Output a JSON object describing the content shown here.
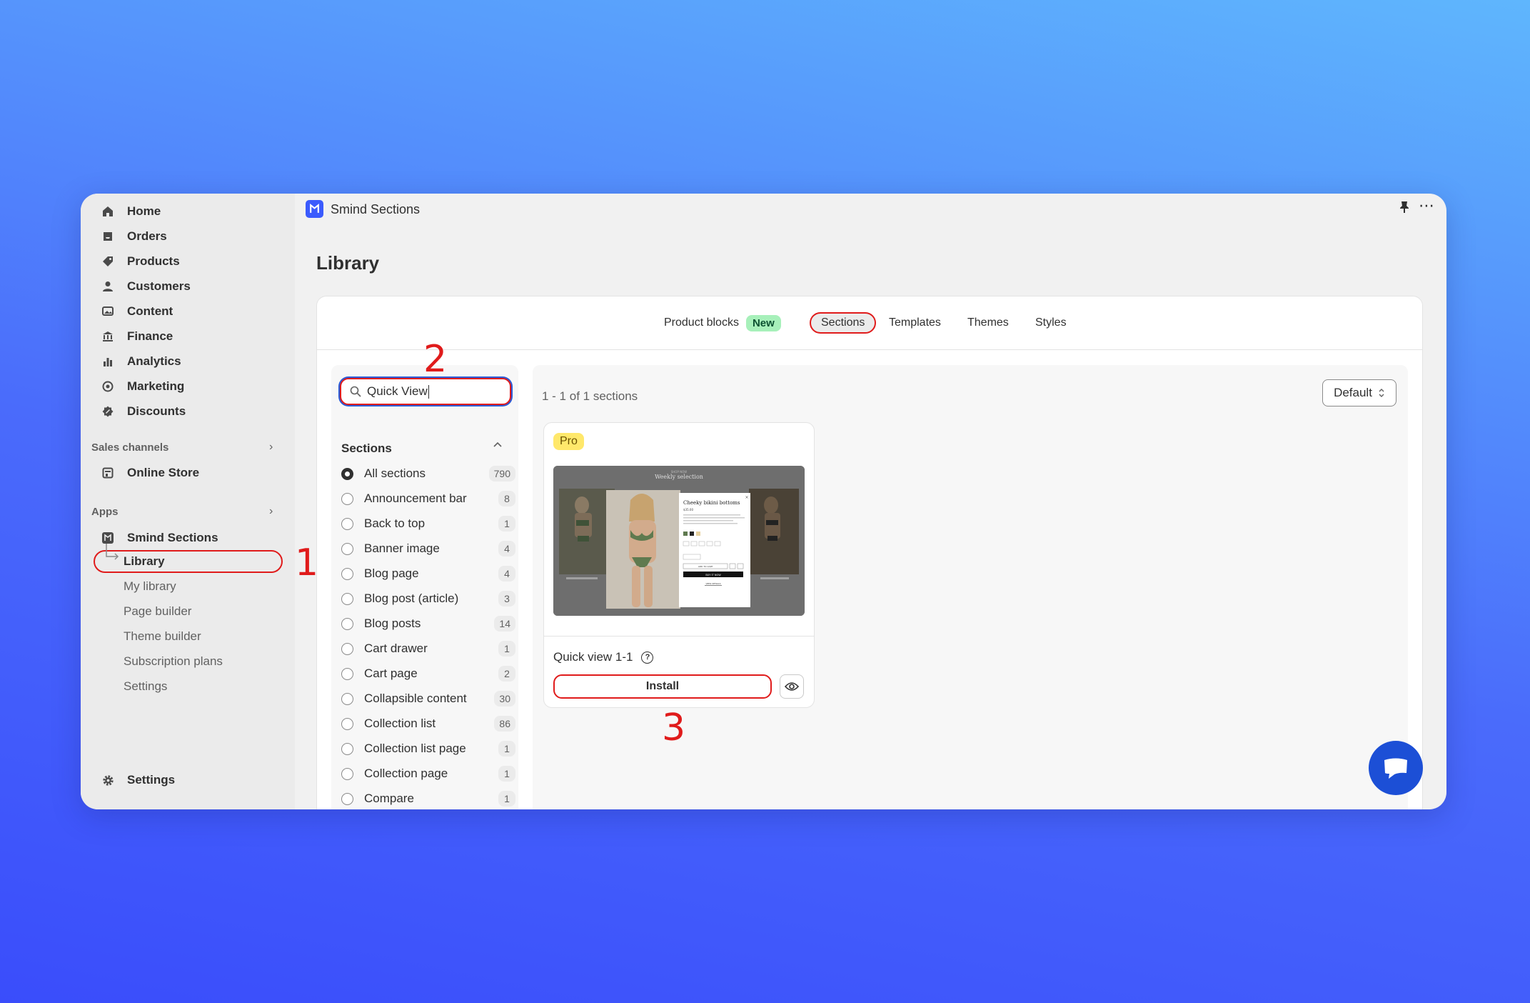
{
  "nav": {
    "main": [
      {
        "label": "Home",
        "icon": "home-icon"
      },
      {
        "label": "Orders",
        "icon": "inbox-icon"
      },
      {
        "label": "Products",
        "icon": "tag-icon"
      },
      {
        "label": "Customers",
        "icon": "person-icon"
      },
      {
        "label": "Content",
        "icon": "image-icon"
      },
      {
        "label": "Finance",
        "icon": "bank-icon"
      },
      {
        "label": "Analytics",
        "icon": "bar-chart-icon"
      },
      {
        "label": "Marketing",
        "icon": "target-icon"
      },
      {
        "label": "Discounts",
        "icon": "discount-icon"
      }
    ],
    "sales_channels_label": "Sales channels",
    "online_store": "Online Store",
    "apps_label": "Apps",
    "app_name": "Smind Sections",
    "app_sub": [
      "Library",
      "My library",
      "Page builder",
      "Theme builder",
      "Subscription plans",
      "Settings"
    ],
    "settings": "Settings"
  },
  "topbar": {
    "app_title": "Smind Sections",
    "logo_text": "S"
  },
  "page": {
    "title": "Library"
  },
  "tabs": {
    "product_blocks": "Product blocks",
    "new_badge": "New",
    "sections": "Sections",
    "templates": "Templates",
    "themes": "Themes",
    "styles": "Styles"
  },
  "search": {
    "value": "Quick View"
  },
  "filters": {
    "heading": "Sections",
    "options": [
      {
        "label": "All sections",
        "count": "790",
        "selected": true
      },
      {
        "label": "Announcement bar",
        "count": "8"
      },
      {
        "label": "Back to top",
        "count": "1"
      },
      {
        "label": "Banner image",
        "count": "4"
      },
      {
        "label": "Blog page",
        "count": "4"
      },
      {
        "label": "Blog post (article)",
        "count": "3"
      },
      {
        "label": "Blog posts",
        "count": "14"
      },
      {
        "label": "Cart drawer",
        "count": "1"
      },
      {
        "label": "Cart page",
        "count": "2"
      },
      {
        "label": "Collapsible content",
        "count": "30"
      },
      {
        "label": "Collection list",
        "count": "86"
      },
      {
        "label": "Collection list page",
        "count": "1"
      },
      {
        "label": "Collection page",
        "count": "1"
      },
      {
        "label": "Compare",
        "count": "1"
      }
    ]
  },
  "results": {
    "count_text": "1 - 1 of 1 sections",
    "sort_value": "Default",
    "card": {
      "badge": "Pro",
      "title": "Quick view 1-1",
      "install_label": "Install",
      "thumb": {
        "store_line": "SHOP NOW",
        "heading": "Weekly selection",
        "modal_title": "Cheeky bikini bottoms",
        "modal_price": "$35.00",
        "add_label": "ADD TO CART",
        "buy_label": "BUY IT NOW",
        "details_label": "VIEW DETAILS"
      }
    }
  },
  "annotations": [
    "1",
    "2",
    "3"
  ],
  "colors": {
    "accent_red": "#e01b1b",
    "brand_blue": "#3b5bfd",
    "badge_new": "#a7f0ba",
    "badge_pro": "#ffe86b"
  }
}
